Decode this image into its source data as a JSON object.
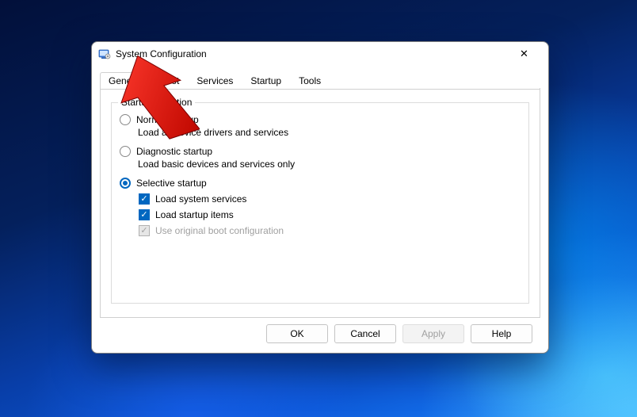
{
  "window": {
    "title": "System Configuration"
  },
  "tabs": [
    {
      "label": "General",
      "active": true
    },
    {
      "label": "Boot",
      "active": false
    },
    {
      "label": "Services",
      "active": false
    },
    {
      "label": "Startup",
      "active": false
    },
    {
      "label": "Tools",
      "active": false
    }
  ],
  "groupbox": {
    "legend": "Startup selection"
  },
  "options": {
    "normal": {
      "label": "Normal startup",
      "desc": "Load all device drivers and services",
      "selected": false
    },
    "diagnostic": {
      "label": "Diagnostic startup",
      "desc": "Load basic devices and services only",
      "selected": false
    },
    "selective": {
      "label": "Selective startup",
      "selected": true
    }
  },
  "selective_subs": {
    "system_services": {
      "label": "Load system services",
      "checked": true,
      "enabled": true
    },
    "startup_items": {
      "label": "Load startup items",
      "checked": true,
      "enabled": true
    },
    "original_boot": {
      "label": "Use original boot configuration",
      "checked": true,
      "enabled": false
    }
  },
  "buttons": {
    "ok": "OK",
    "cancel": "Cancel",
    "apply": "Apply",
    "help": "Help"
  },
  "glyphs": {
    "check": "✓",
    "close": "✕"
  }
}
